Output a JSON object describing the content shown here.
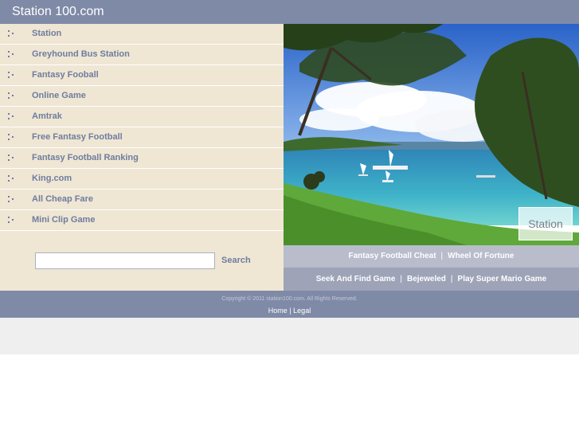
{
  "header": {
    "title": "Station 100.com"
  },
  "nav": {
    "items": [
      "Station",
      "Greyhound Bus Station",
      "Fantasy Fooball",
      "Online Game",
      "Amtrak",
      "Free Fantasy Football",
      "Fantasy Football Ranking",
      "King.com",
      "All Cheap Fare",
      "Mini Clip Game"
    ]
  },
  "search": {
    "placeholder": "",
    "button_label": "Search"
  },
  "photo": {
    "stamp_label": "Station"
  },
  "links": {
    "row1": [
      "Fantasy Football Cheat",
      "Wheel Of Fortune"
    ],
    "row2": [
      "Seek And Find Game",
      "Bejeweled",
      "Play Super Mario Game"
    ],
    "separator": "|"
  },
  "footer": {
    "copyright": "Copyright © 2011 station100.com. All Rights Reserved.",
    "home_label": "Home",
    "legal_label": "Legal",
    "separator": "|"
  }
}
